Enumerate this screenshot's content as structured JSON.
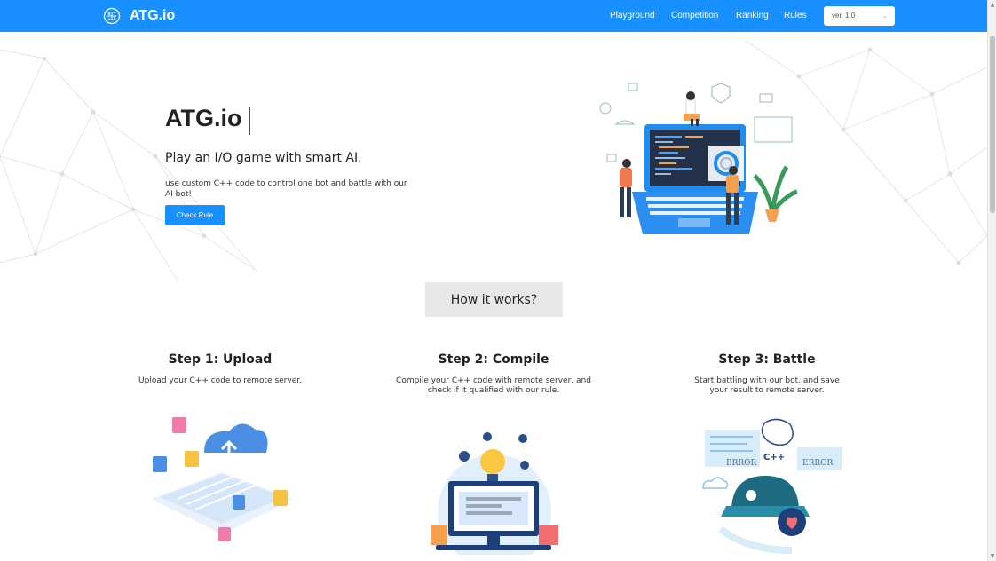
{
  "brand": {
    "name": "ATG.io",
    "logo_icon": "brain-circuit-icon"
  },
  "nav": {
    "items": [
      "Playground",
      "Competition",
      "Ranking",
      "Rules"
    ],
    "version_select": {
      "value": "ver. 1.0",
      "icon": "chevron-down-icon"
    }
  },
  "hero": {
    "title": "ATG.io",
    "subtitle": "Play an I/O game with smart AI.",
    "description": "use custom C++ code to control one bot and battle with our AI bot!",
    "button": "Check Rule"
  },
  "how": {
    "title": "How it works?"
  },
  "steps": [
    {
      "title": "Step 1: Upload",
      "description": "Upload your C++ code to remote server."
    },
    {
      "title": "Step 2: Compile",
      "description": "Compile your C++ code with remote server, and check if it qualified with our rule."
    },
    {
      "title": "Step 3: Battle",
      "description": "Start battling with our bot, and save your result to remote server."
    }
  ],
  "illustration_text": {
    "cpp": "C++",
    "error": "ERROR"
  },
  "colors": {
    "primary": "#1890ff",
    "how_bg": "#e8e8e8"
  }
}
